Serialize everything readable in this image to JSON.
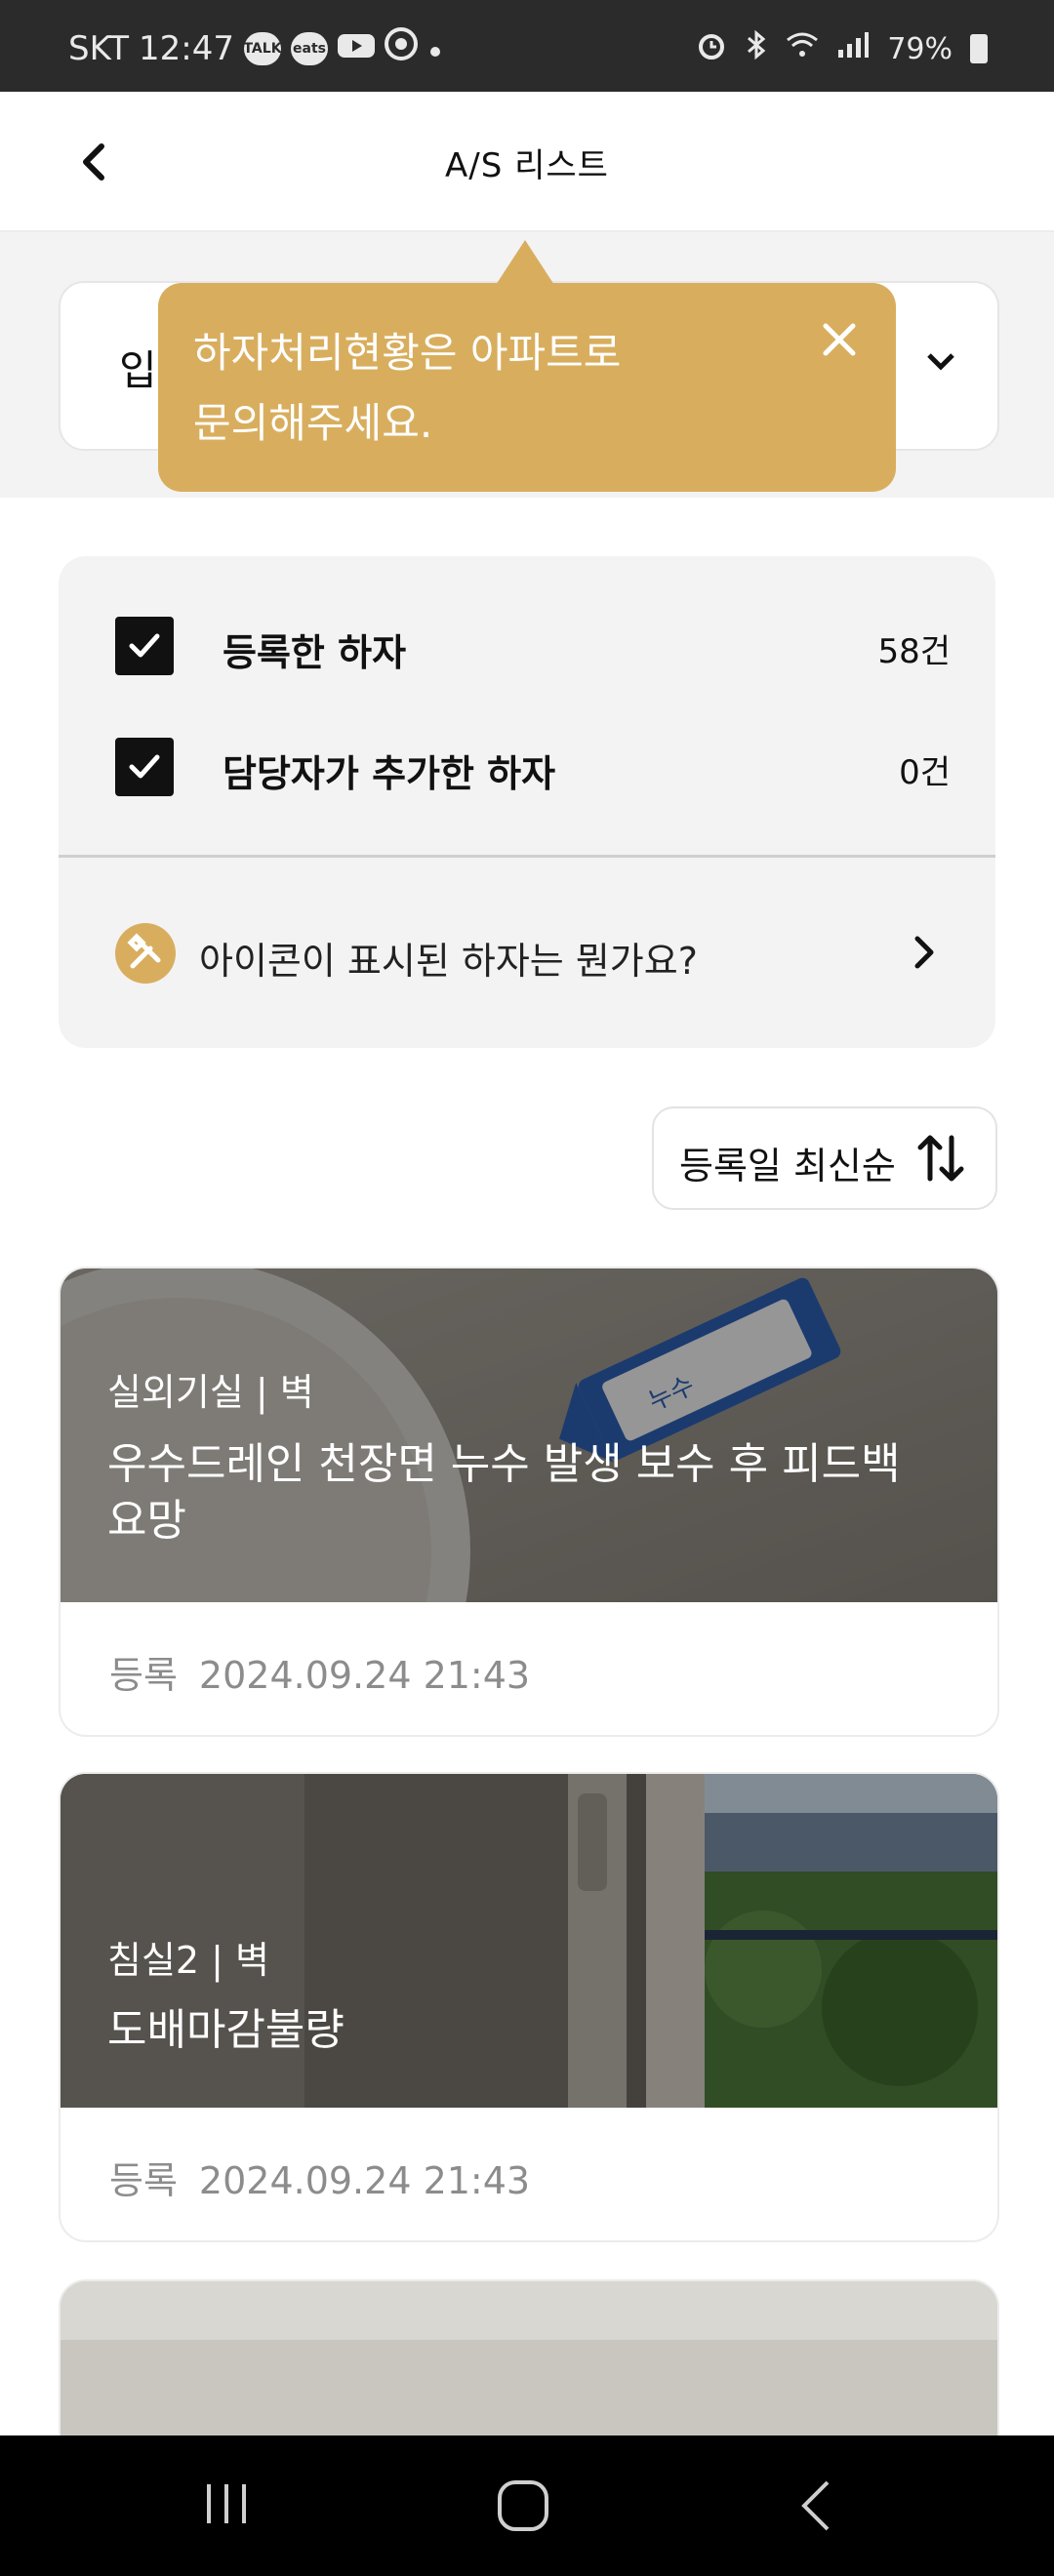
{
  "status_bar": {
    "carrier": "SKT",
    "time": "12:47",
    "app_icons": [
      "talk-icon",
      "eats-icon",
      "youtube-icon",
      "chrome-icon",
      "dot-icon"
    ],
    "talk_label": "TALK",
    "eats_label": "eats",
    "system_icons": [
      "alarm-icon",
      "bluetooth-icon",
      "wifi-icon",
      "signal-icon"
    ],
    "battery": "79%"
  },
  "header": {
    "title": "A/S 리스트",
    "back_icon": "chevron-left-icon"
  },
  "selector": {
    "value_visible": "입",
    "icon": "chevron-down-icon"
  },
  "tooltip": {
    "text": "하자처리현황은 아파트로\n문의해주세요.",
    "close_icon": "close-icon",
    "color": "#D8AE5E"
  },
  "filters": [
    {
      "label": "등록한 하자",
      "count": "58건",
      "checked": true
    },
    {
      "label": "담당자가 추가한 하자",
      "count": "0건",
      "checked": true
    }
  ],
  "help": {
    "text": "아이콘이 표시된 하자는 뭔가요?",
    "icon": "tools-icon"
  },
  "sort": {
    "label": "등록일 최신순",
    "icon": "sort-arrows-icon"
  },
  "items": [
    {
      "category": "실외기실 | 벽",
      "title": "우수드레인 천장면 누수 발생 보수 후 피드백 요망",
      "meta_label": "등록",
      "date": "2024.09.24 21:43",
      "photo_note": "누수"
    },
    {
      "category": "침실2 | 벽",
      "title": "도배마감불량",
      "meta_label": "등록",
      "date": "2024.09.24 21:43"
    }
  ],
  "nav": {
    "recents_icon": "recents-icon",
    "home_icon": "home-icon",
    "back_icon": "back-icon"
  }
}
